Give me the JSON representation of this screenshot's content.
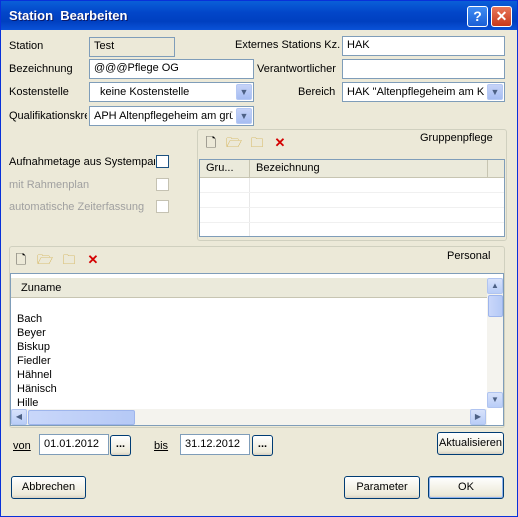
{
  "window": {
    "title": "Station  Bearbeiten",
    "help_glyph": "?",
    "close_glyph": "✕"
  },
  "form": {
    "station_label": "Station",
    "station_value": "Test",
    "bezeichnung_label": "Bezeichnung",
    "bezeichnung_value": "@@@Pflege OG",
    "kostenstelle_label": "Kostenstelle",
    "kostenstelle_value": "keine Kostenstelle",
    "qualifikation_label": "Qualifikationskre",
    "qualifikation_value": "APH Altenpflegeheim am grür",
    "ext_kz_label": "Externes Stations Kz.",
    "ext_kz_value": "HAK",
    "verantwortlicher_label": "Verantwortlicher",
    "verantwortlicher_value": "",
    "bereich_label": "Bereich",
    "bereich_value": "HAK \"Altenpflegeheim am Kur",
    "aufnahmetage_label": "Aufnahmetage aus Systemparame",
    "rahmenplan_label": "mit Rahmenplan",
    "zeiterfassung_label": "automatische Zeiterfassung"
  },
  "gruppenpflege": {
    "title": "Gruppenpflege",
    "columns": [
      "Gru...",
      "Bezeichnung"
    ]
  },
  "personal": {
    "title": "Personal",
    "column": "Zuname",
    "rows": [
      "Bach",
      "Beyer",
      "Biskup",
      "Fiedler",
      "Hähnel",
      "Hänisch",
      "Hille"
    ]
  },
  "date_range": {
    "von_label": "von",
    "von_value": "01.01.2012",
    "bis_label": "bis",
    "bis_value": "31.12.2012",
    "picker_label": "...",
    "refresh_label": "Aktualisieren"
  },
  "buttons": {
    "cancel": "Abbrechen",
    "parameter": "Parameter",
    "ok": "OK"
  },
  "icons": {
    "new": "new-document-icon",
    "open": "open-folder-icon",
    "edit": "edit-folder-icon",
    "delete": "delete-icon"
  },
  "colors": {
    "titlebar": "#0a5fd8",
    "window_bg": "#ece9d8",
    "delete_red": "#d40000",
    "field_border": "#7f9db9"
  }
}
